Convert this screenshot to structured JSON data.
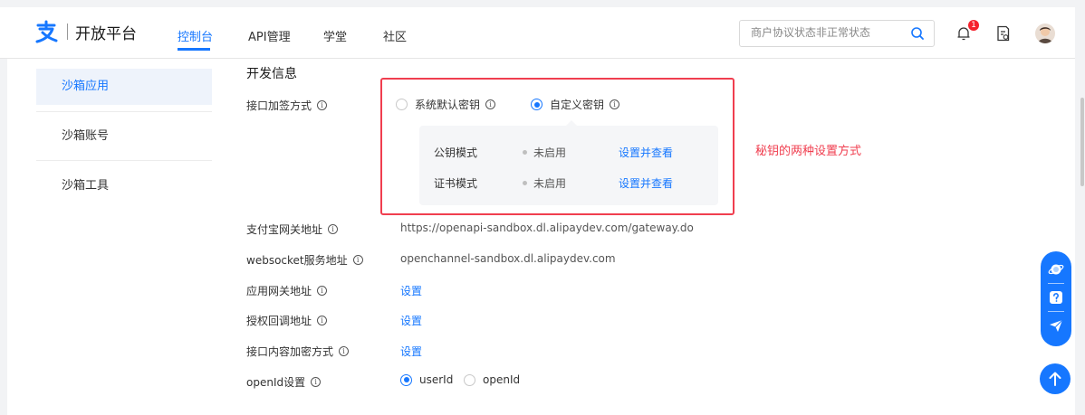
{
  "brand": {
    "logo_text": "开放平台",
    "accent": "#1677ff"
  },
  "nav": {
    "items": [
      {
        "label": "控制台",
        "active": true
      },
      {
        "label": "API管理",
        "active": false
      },
      {
        "label": "学堂",
        "active": false
      },
      {
        "label": "社区",
        "active": false
      }
    ]
  },
  "search": {
    "placeholder": "商户协议状态非正常状态"
  },
  "notifications": {
    "count": "1"
  },
  "sidebar": {
    "items": [
      {
        "label": "沙箱应用",
        "active": true
      },
      {
        "label": "沙箱账号",
        "active": false
      },
      {
        "label": "沙箱工具",
        "active": false
      }
    ]
  },
  "main": {
    "section_title": "开发信息",
    "sign_method": {
      "label": "接口加签方式",
      "options": [
        {
          "label": "系统默认密钥",
          "selected": false
        },
        {
          "label": "自定义密钥",
          "selected": true
        }
      ],
      "modes": [
        {
          "label": "公钥模式",
          "status": "未启用",
          "action": "设置并查看"
        },
        {
          "label": "证书模式",
          "status": "未启用",
          "action": "设置并查看"
        }
      ]
    },
    "annotation": "秘钥的两种设置方式",
    "gateway": {
      "label": "支付宝网关地址",
      "value": "https://openapi-sandbox.dl.alipaydev.com/gateway.do"
    },
    "websocket": {
      "label": "websocket服务地址",
      "value": "openchannel-sandbox.dl.alipaydev.com"
    },
    "app_gateway": {
      "label": "应用网关地址",
      "action": "设置"
    },
    "auth_callback": {
      "label": "授权回调地址",
      "action": "设置"
    },
    "content_encrypt": {
      "label": "接口内容加密方式",
      "action": "设置"
    },
    "openid": {
      "label": "openId设置",
      "options": [
        {
          "label": "userId",
          "selected": true
        },
        {
          "label": "openId",
          "selected": false
        }
      ]
    }
  },
  "colors": {
    "highlight_box": "#f03e4f",
    "link": "#1677ff"
  }
}
